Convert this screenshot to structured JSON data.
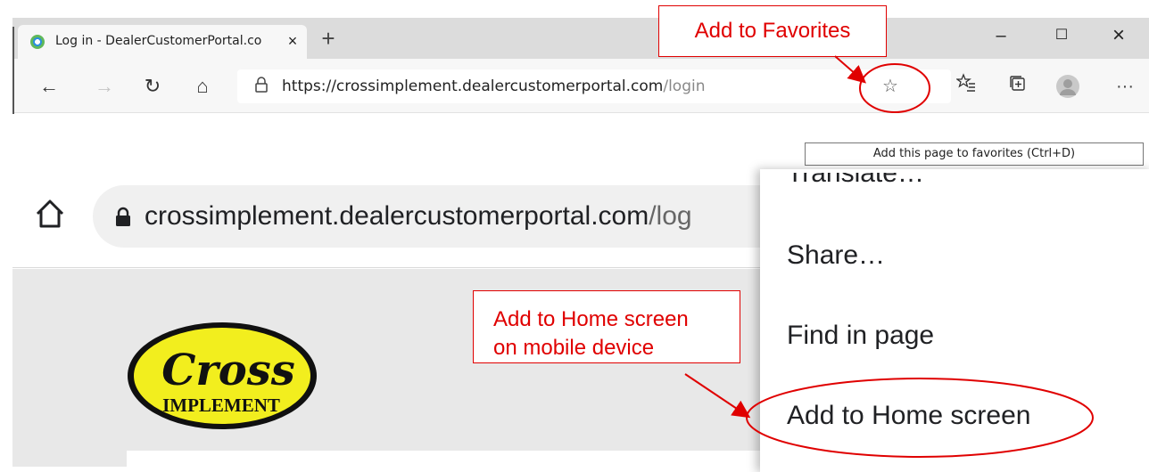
{
  "desktop_browser": {
    "tab": {
      "title": "Log in - DealerCustomerPortal.co",
      "close_glyph": "×",
      "icon": "portal-favicon-icon"
    },
    "new_tab_glyph": "+",
    "window_controls": {
      "minimize": "–",
      "maximize": "☐",
      "close": "×"
    },
    "nav": {
      "back": "←",
      "forward": "→",
      "refresh": "↻",
      "home": "⌂"
    },
    "address": {
      "lock": "🔒",
      "url_host": "https://crossimplement.dealercustomerportal.com",
      "url_path": "/login"
    },
    "favorite_star": "☆",
    "toolbar": {
      "favorites_list": "☆≡",
      "collections": "⊞",
      "more": "···"
    },
    "tooltip": "Add this page to favorites (Ctrl+D)"
  },
  "mobile_browser": {
    "url_host": "crossimplement.dealercustomerportal.com",
    "url_path": "/log",
    "menu": {
      "translate": "Translate…",
      "share": "Share…",
      "find": "Find in page",
      "add_home": "Add to Home screen"
    },
    "logo": {
      "line1": "Cross",
      "line2": "IMPLEMENT"
    }
  },
  "annotations": {
    "favorites_callout": "Add to Favorites",
    "home_callout_line1": "Add to Home screen",
    "home_callout_line2": "on mobile device",
    "color": "#e00000"
  }
}
